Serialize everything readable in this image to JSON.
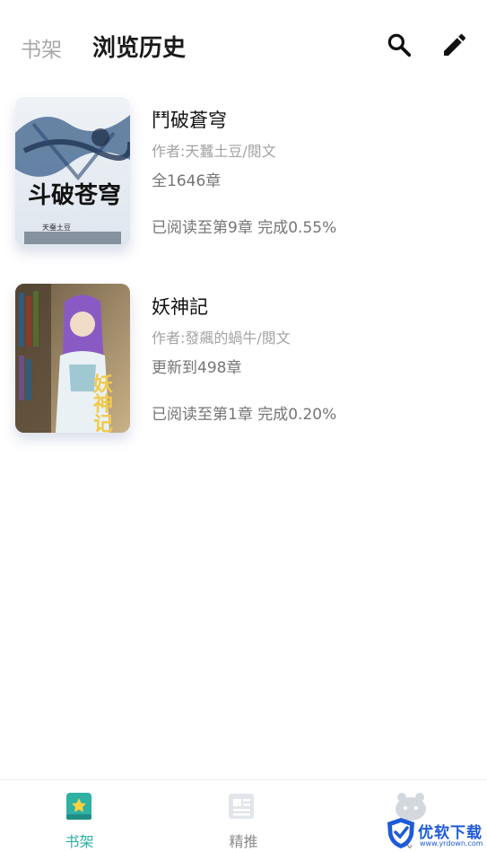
{
  "header": {
    "tab_shelf": "书架",
    "tab_history": "浏览历史",
    "search_icon": "search-icon",
    "edit_icon": "edit-icon"
  },
  "books": [
    {
      "title": "鬥破蒼穹",
      "author": "作者:天蠶土豆/閱文",
      "chapters": "全1646章",
      "progress": "已阅读至第9章 完成0.55%",
      "cover_text": "斗破苍穹"
    },
    {
      "title": "妖神記",
      "author": "作者:發飆的蝸牛/閱文",
      "chapters": "更新到498章",
      "progress": "已阅读至第1章 完成0.20%",
      "cover_text": "妖神记"
    }
  ],
  "bottom_nav": {
    "items": [
      {
        "label": "书架",
        "icon": "bookshelf-icon",
        "active": true
      },
      {
        "label": "精推",
        "icon": "recommend-icon",
        "active": false
      },
      {
        "label": "我",
        "icon": "profile-icon",
        "active": false
      }
    ]
  },
  "watermark": {
    "text": "优软下载",
    "url": "www.yrdown.com"
  },
  "colors": {
    "accent": "#2fb1a4",
    "inactive": "#8b8b8b",
    "watermark": "#1d5bd8"
  }
}
